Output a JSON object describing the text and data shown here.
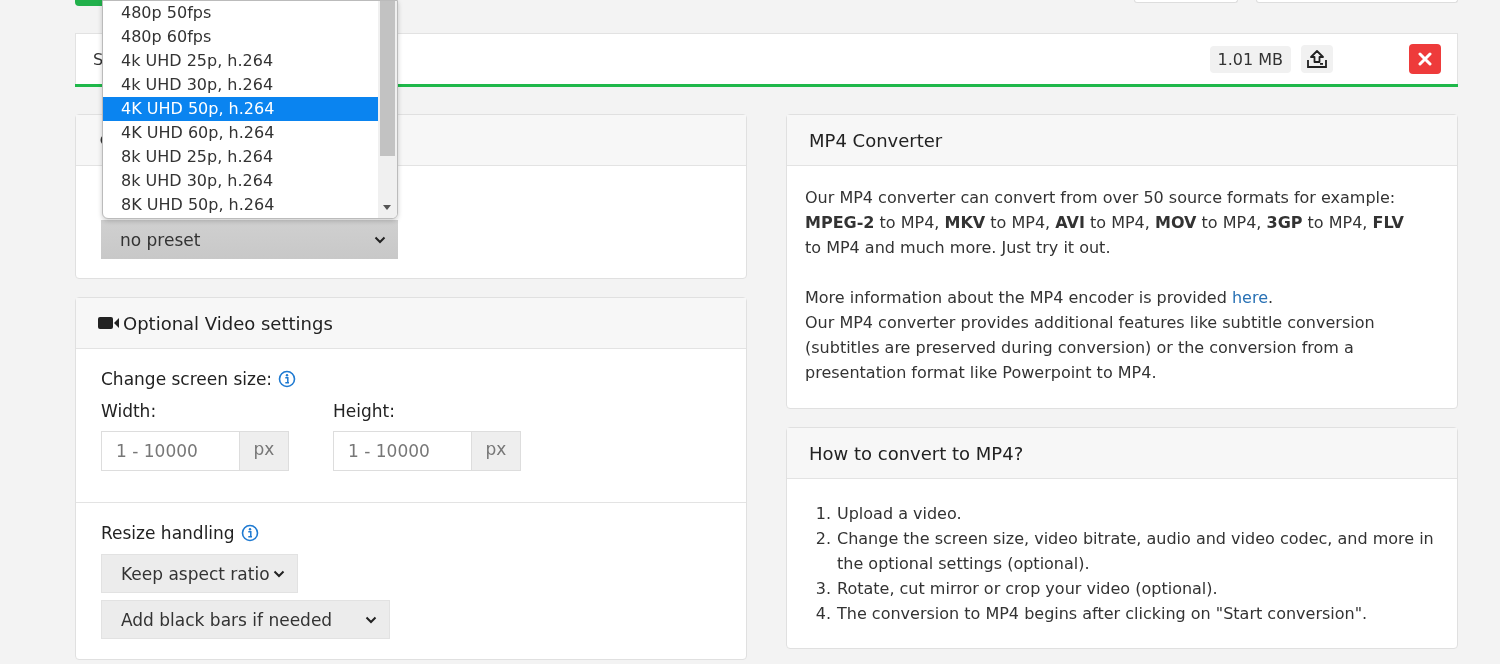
{
  "file": {
    "name": "S",
    "size": "1.01 MB",
    "level": 1
  },
  "preset": {
    "value": "no preset",
    "options": [
      {
        "label": "480p 50fps",
        "selected": false
      },
      {
        "label": "480p 60fps",
        "selected": false
      },
      {
        "label": "4k UHD 25p, h.264",
        "selected": false
      },
      {
        "label": "4k UHD 30p, h.264",
        "selected": false
      },
      {
        "label": "4K UHD 50p, h.264",
        "selected": true
      },
      {
        "label": "4K UHD 60p, h.264",
        "selected": false
      },
      {
        "label": "8k UHD 25p, h.264",
        "selected": false
      },
      {
        "label": "8k UHD 30p, h.264",
        "selected": false
      },
      {
        "label": "8K UHD 50p, h.264",
        "selected": false
      }
    ]
  },
  "video_settings": {
    "title": "Optional Video settings",
    "screen_size_label": "Change screen size:",
    "width": {
      "label": "Width:",
      "placeholder": "1 - 10000",
      "unit": "px"
    },
    "height": {
      "label": "Height:",
      "placeholder": "1 - 10000",
      "unit": "px"
    },
    "resize_label": "Resize handling",
    "resize_selects": [
      "Keep aspect ratio",
      "Add black bars if needed"
    ]
  },
  "converter": {
    "title": "MP4 Converter",
    "intro": "Our MP4 converter can convert from over 50 source formats for example: **MPEG-2** to MP4, **MKV** to MP4, **AVI** to MP4, **MOV** to MP4, **3GP** to MP4, **FLV** to MP4 and much more. Just try it out.",
    "more_before": "More information about the MP4 encoder is provided ",
    "more_link": "here",
    "more_after": ".",
    "features": "Our MP4 converter provides additional features like subtitle conversion (subtitles are preserved during conversion) or the conversion from a presentation format like Powerpoint to MP4."
  },
  "howto": {
    "title": "How to convert to MP4?",
    "steps": [
      {
        "number": "1.",
        "text": "Upload a video."
      },
      {
        "number": "2.",
        "text": "Change the screen size, video bitrate, audio and video codec, and more in the optional settings (optional)."
      },
      {
        "number": "3.",
        "text": "Rotate, cut mirror or crop your video (optional)."
      },
      {
        "number": "4.",
        "text": "The conversion to MP4 begins after clicking on \"Start conversion\"."
      }
    ]
  }
}
